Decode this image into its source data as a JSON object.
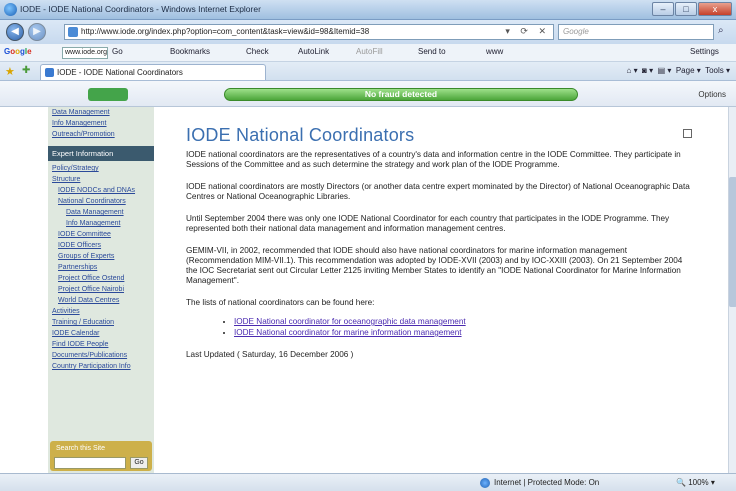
{
  "window": {
    "title": "IODE - IODE National Coordinators - Windows Internet Explorer",
    "buttons": [
      "–",
      "□",
      "x"
    ]
  },
  "address_bar": {
    "url": "http://www.iode.org/index.php?option=com_content&task=view&id=98&Itemid=38",
    "search_placeholder": "Google"
  },
  "google_toolbar": {
    "logo": [
      "G",
      "o",
      "o",
      "g",
      "l",
      "e"
    ],
    "site_box": "www.iode.org",
    "go_label": "Go",
    "bookmarks": "Bookmarks",
    "check": "Check",
    "autolink": "AutoLink",
    "autofill": "AutoFill",
    "sendto": "Send to",
    "www": "www",
    "settings": "Settings"
  },
  "tabs": {
    "active_tab": "IODE - IODE National Coordinators",
    "page_menu": "Page",
    "tools_menu": "Tools"
  },
  "addon_toolbar": {
    "status": "No fraud detected",
    "options": "Options"
  },
  "sidebar": {
    "items": [
      {
        "label": "Data Management",
        "level": 1
      },
      {
        "label": "Info Management",
        "level": 1
      },
      {
        "label": "Outreach/Promotion",
        "level": 1
      }
    ],
    "section_header": "Expert Information",
    "items2": [
      {
        "label": "Policy/Strategy",
        "level": 1
      },
      {
        "label": "Structure",
        "level": 1
      },
      {
        "label": "IODE NODCs and DNAs",
        "level": 2
      },
      {
        "label": "National Coordinators",
        "level": 2
      },
      {
        "label": "Data Management",
        "level": 3
      },
      {
        "label": "Info Management",
        "level": 3
      },
      {
        "label": "IODE Committee",
        "level": 2
      },
      {
        "label": "IODE Officers",
        "level": 2
      },
      {
        "label": "Groups of Experts",
        "level": 2
      },
      {
        "label": "Partnerships",
        "level": 2
      },
      {
        "label": "Project Office Ostend",
        "level": 2
      },
      {
        "label": "Project Office Nairobi",
        "level": 2
      },
      {
        "label": "World Data Centres",
        "level": 2
      },
      {
        "label": "Activities",
        "level": 1
      },
      {
        "label": "Training / Education",
        "level": 1
      },
      {
        "label": "IODE Calendar",
        "level": 1
      },
      {
        "label": "Find IODE People",
        "level": 1
      },
      {
        "label": "Documents/Publications",
        "level": 1
      },
      {
        "label": "Country Participation Info",
        "level": 1
      }
    ],
    "search": {
      "label": "Search this Site",
      "button": "Go"
    }
  },
  "content": {
    "title": "IODE National Coordinators",
    "paragraphs": [
      "IODE national coordinators are the representatives of a country's data and information centre in the IODE Committee. They participate in Sessions of the Committee and as such determine the strategy and work plan of the IODE Programme.",
      "IODE national coordinators are mostly Directors (or another data centre expert mominated by the Director) of National Oceanographic Data Centres or National Oceanographic Libraries.",
      "Until September 2004 there was only one IODE National Coordinator for each country that participates in the IODE Programme. They represented both their national data management and information management centres.",
      "GEMIM-VII, in 2002, recommended that IODE should also have national coordinators for marine information management (Recommendation MIM-VII.1). This recommendation was adopted by IODE-XVII (2003) and by IOC-XXIII (2003). On 21 September 2004 the IOC Secretariat sent out Circular Letter 2125 inviting Member States to identify an \"IODE National Coordinator for Marine Information Management\".",
      "The lists of national coordinators can be found here:"
    ],
    "links": [
      "IODE National coordinator for oceanographic data management",
      "IODE National coordinator for marine information management"
    ],
    "last_updated": "Last Updated ( Saturday, 16 December 2006 )"
  },
  "statusbar": {
    "zone": "Internet | Protected Mode: On",
    "zoom": "100%"
  }
}
